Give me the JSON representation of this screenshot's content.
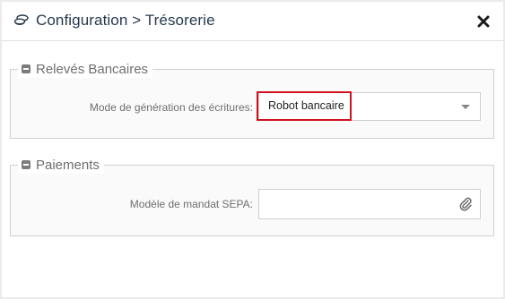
{
  "dialog": {
    "title": "Configuration > Trésorerie",
    "title_icon": "coins-icon",
    "close_icon": "close-icon"
  },
  "sections": {
    "releves": {
      "legend": "Relevés Bancaires",
      "field_label": "Mode de génération des écritures:",
      "field_value": "Robot bancaire"
    },
    "paiements": {
      "legend": "Paiements",
      "field_label": "Modèle de mandat SEPA:",
      "field_value": "",
      "field_icon": "paperclip-icon"
    }
  },
  "colors": {
    "title": "#253a4e",
    "highlight": "#d2121f",
    "section_bg": "#fafafa"
  }
}
